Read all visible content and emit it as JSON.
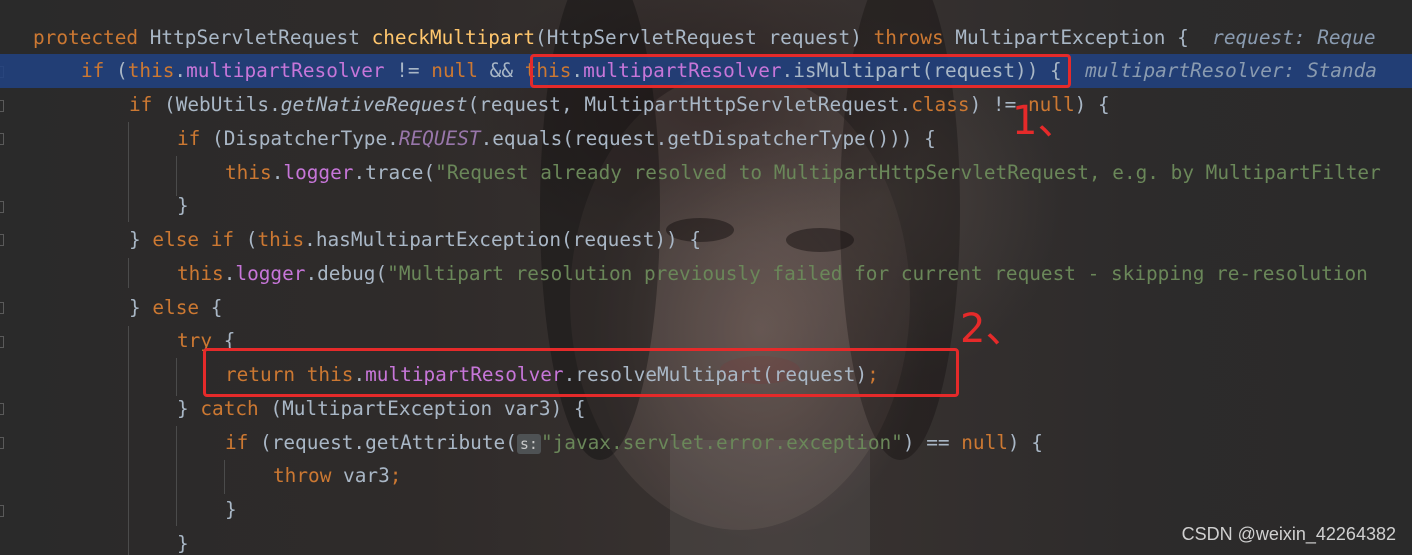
{
  "colors": {
    "keyword": "#cc7832",
    "method": "#ffc66d",
    "field": "#c776d9",
    "string": "#6a8759",
    "text": "#a9b7c6",
    "highlight_row": "#214283",
    "annotation": "#e52a2a"
  },
  "code": {
    "l1": {
      "kw1": "protected",
      "t1": " HttpServletRequest ",
      "fn": "checkMultipart",
      "t2": "(HttpServletRequest request) ",
      "kw2": "throws",
      "t3": " MultipartException {",
      "hint": "  request: Reque"
    },
    "l2": {
      "kw1": "if",
      "t1": " (",
      "kw2": "this",
      "t2": ".",
      "fld1": "multipartResolver",
      "t3": " != ",
      "kw3": "null",
      "t4": " && ",
      "kw4": "this",
      "t5": ".",
      "fld2": "multipartResolver",
      "t6": ".isMultipart(request)) {",
      "hint": "  multipartResolver: Standa"
    },
    "l3": {
      "kw1": "if",
      "t1": " (WebUtils.",
      "fn": "getNativeRequest",
      "t2": "(request, MultipartHttpServletRequest.",
      "kw2": "class",
      "t3": ") != ",
      "kw3": "null",
      "t4": ") {"
    },
    "l4": {
      "kw1": "if",
      "t1": " (DispatcherType.",
      "const": "REQUEST",
      "t2": ".equals(request.getDispatcherType())) {"
    },
    "l5": {
      "kw1": "this",
      "t1": ".",
      "fld": "logger",
      "t2": ".trace(",
      "str": "\"Request already resolved to MultipartHttpServletRequest, e.g. by MultipartFilter"
    },
    "l6": {
      "t1": "}"
    },
    "l7": {
      "t1": "} ",
      "kw1": "else if",
      "t2": " (",
      "kw2": "this",
      "t3": ".hasMultipartException(request)) {"
    },
    "l8": {
      "kw1": "this",
      "t1": ".",
      "fld": "logger",
      "t2": ".debug(",
      "str": "\"Multipart resolution previously failed for current request - skipping re-resolution"
    },
    "l9": {
      "t1": "} ",
      "kw1": "else",
      "t2": " {"
    },
    "l10": {
      "kw1": "try",
      "t1": " {"
    },
    "l11": {
      "kw1": "return",
      "t1": " ",
      "kw2": "this",
      "t2": ".",
      "fld": "multipartResolver",
      "t3": ".resolveMultipart(request)",
      "kw3": ";"
    },
    "l12": {
      "t1": "} ",
      "kw1": "catch",
      "t2": " (MultipartException var3) {"
    },
    "l13": {
      "kw1": "if",
      "t1": " (request.getAttribute(",
      "param": "s:",
      "str": "\"javax.servlet.error.exception\"",
      "t2": ") == ",
      "kw2": "null",
      "t3": ") {"
    },
    "l14": {
      "kw1": "throw",
      "t1": " var3",
      "kw2": ";"
    },
    "l15": {
      "t1": "}"
    },
    "l16": {
      "t1": "}"
    }
  },
  "annotations": {
    "label1": "1、",
    "label2": "2、"
  },
  "watermark": "CSDN @weixin_42264382"
}
